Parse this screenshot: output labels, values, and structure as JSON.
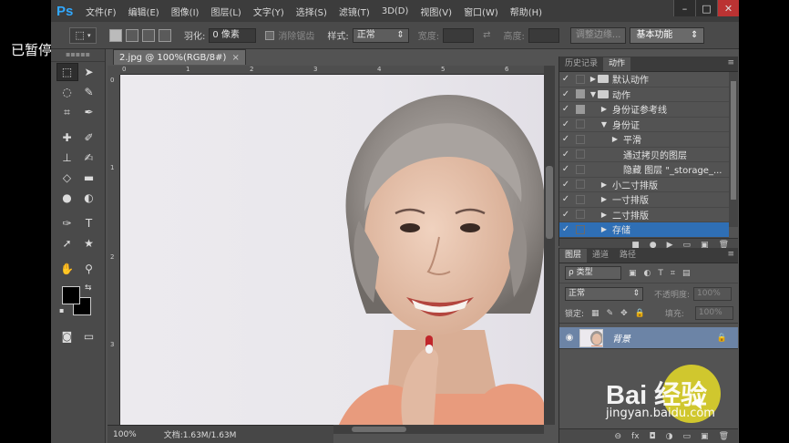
{
  "overlay": {
    "paused_label": "已暂停"
  },
  "menubar": {
    "logo": "Ps",
    "items": [
      "文件(F)",
      "编辑(E)",
      "图像(I)",
      "图层(L)",
      "文字(Y)",
      "选择(S)",
      "滤镜(T)",
      "3D(D)",
      "视图(V)",
      "窗口(W)",
      "帮助(H)"
    ],
    "window_controls": [
      "–",
      "□",
      "✕"
    ]
  },
  "options": {
    "feather_label": "羽化:",
    "feather_value": "0 像素",
    "antialias_label": "消除锯齿",
    "style_label": "样式:",
    "style_value": "正常",
    "width_label": "宽度:",
    "height_label": "高度:",
    "refine_edge_button": "调整边缘...",
    "workspace_value": "基本功能"
  },
  "document": {
    "tab_title": "2.jpg @ 100%(RGB/8#)",
    "close_glyph": "×",
    "ruler_top_numbers": [
      "0",
      "1",
      "2",
      "3",
      "4",
      "5",
      "6"
    ],
    "ruler_left_numbers": [
      "0",
      "1",
      "2",
      "3"
    ],
    "zoom": "100%",
    "doc_info": "文档:1.63M/1.63M"
  },
  "actions_panel": {
    "tabs": [
      "历史记录",
      "动作"
    ],
    "active_tab": 1,
    "rows": [
      {
        "check": "✓",
        "dialog": false,
        "tri": "▶",
        "folder": true,
        "indent": 0,
        "label": "默认动作",
        "selected": false
      },
      {
        "check": "✓",
        "dialog": true,
        "tri": "▼",
        "folder": true,
        "indent": 0,
        "label": "动作",
        "selected": false
      },
      {
        "check": "✓",
        "dialog": true,
        "tri": "▶",
        "folder": false,
        "indent": 1,
        "label": "身份证参考线",
        "selected": false
      },
      {
        "check": "✓",
        "dialog": false,
        "tri": "▼",
        "folder": false,
        "indent": 1,
        "label": "身份证",
        "selected": false
      },
      {
        "check": "✓",
        "dialog": false,
        "tri": "▶",
        "folder": false,
        "indent": 2,
        "label": "平滑",
        "selected": false
      },
      {
        "check": "✓",
        "dialog": false,
        "tri": "",
        "folder": false,
        "indent": 2,
        "label": "通过拷贝的图层",
        "selected": false
      },
      {
        "check": "✓",
        "dialog": false,
        "tri": "",
        "folder": false,
        "indent": 2,
        "label": "隐藏 图层 \"_storage_...",
        "selected": false
      },
      {
        "check": "✓",
        "dialog": false,
        "tri": "▶",
        "folder": false,
        "indent": 1,
        "label": "小二寸排版",
        "selected": false
      },
      {
        "check": "✓",
        "dialog": false,
        "tri": "▶",
        "folder": false,
        "indent": 1,
        "label": "一寸排版",
        "selected": false
      },
      {
        "check": "✓",
        "dialog": false,
        "tri": "▶",
        "folder": false,
        "indent": 1,
        "label": "二寸排版",
        "selected": false
      },
      {
        "check": "✓",
        "dialog": false,
        "tri": "▶",
        "folder": false,
        "indent": 1,
        "label": "存储",
        "selected": true
      }
    ],
    "bottom_icons": [
      "■",
      "●",
      "▶",
      "▭",
      "▣",
      "🗑"
    ]
  },
  "layers_panel": {
    "tabs": [
      "图层",
      "通道",
      "路径"
    ],
    "active_tab": 0,
    "filter_label": "ρ 类型",
    "filter_icons": [
      "▣",
      "◐",
      "T",
      "⌗",
      "▤"
    ],
    "blend_mode": "正常",
    "opacity_label": "不透明度:",
    "opacity_value": "100%",
    "lock_label": "锁定:",
    "lock_icons": [
      "▦",
      "✎",
      "✥",
      "🔒"
    ],
    "fill_label": "填充:",
    "fill_value": "100%",
    "layer_name": "背景",
    "bottom_icons": [
      "⊖",
      "fx",
      "◘",
      "◑",
      "▭",
      "▣",
      "🗑"
    ]
  },
  "watermark": {
    "logo_text": "Bai 经验",
    "url": "jingyan.baidu.com"
  }
}
